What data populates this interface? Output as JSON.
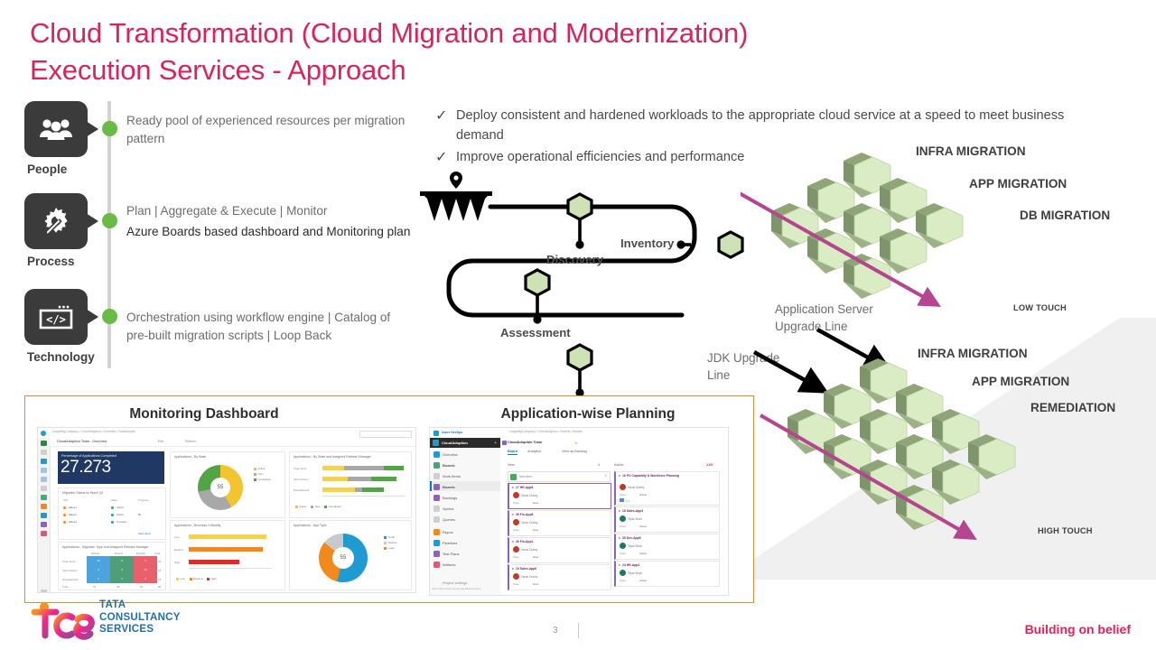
{
  "title": {
    "line1": "Cloud Transformation (Cloud Migration and Modernization)",
    "line2": "Execution Services - Approach",
    "color": "#d8235c"
  },
  "pillars": [
    {
      "label": "People",
      "icon": "people-icon",
      "text": "Ready pool of experienced resources per migration pattern"
    },
    {
      "label": "Process",
      "icon": "gear-wrench-icon",
      "text_primary": "Plan | Aggregate & Execute | Monitor",
      "text_secondary": "Azure Boards based dashboard and Monitoring  plan"
    },
    {
      "label": "Technology",
      "icon": "code-window-icon",
      "text": "Orchestration using workflow engine | Catalog of pre-built migration scripts | Loop Back"
    }
  ],
  "bullets": [
    "Deploy consistent and hardened  workloads to the  appropriate cloud service at a speed  to meet business  demand",
    "Improve operational efficiencies and performance"
  ],
  "flow": {
    "nodes": [
      "Discovery",
      "Inventory",
      "Assessment"
    ],
    "start_icon": "funnel-pin-icon"
  },
  "annotations": {
    "app_server": "Application Server Upgrade Line",
    "jdk": "JDK Upgrade Line"
  },
  "clusters": [
    {
      "name": "low-touch-cluster",
      "labels": [
        "INFRA MIGRATION",
        "APP MIGRATION",
        "DB MIGRATION"
      ],
      "touch": "LOW TOUCH"
    },
    {
      "name": "high-touch-cluster",
      "labels": [
        "INFRA MIGRATION",
        "APP MIGRATION",
        "REMEDIATION"
      ],
      "touch": "HIGH TOUCH"
    }
  ],
  "screenshots": {
    "dashboard": {
      "title": "Monitoring Dashboard",
      "breadcrumb": "LargeMigCompany  /  CloudAdoption  /  Overview  /  Dashboards",
      "search_placeholder": "Search",
      "toolbar_title": "CloudAdoption Team - Overview",
      "toolbar_edit": "Edit",
      "toolbar_refresh": "Refresh",
      "kpi": {
        "title": "Percentage of Applications Completed",
        "value": "27.273"
      },
      "wave_card": {
        "title": "Migration Status by Wave (3)",
        "columns": [
          "Title",
          "State",
          "Progress"
        ],
        "rows": [
          {
            "title": "Wave1",
            "state": "Active",
            "progress": ""
          },
          {
            "title": "Wave2",
            "state": "Active",
            "progress": "80"
          },
          {
            "title": "Wave3",
            "state": "Complet..",
            "progress": ""
          }
        ],
        "link": "View query"
      },
      "matrix_card": {
        "title": "Applications - Migration Type And Assigned Release Manager",
        "columns": [
          "Rehost",
          "Rehost",
          "Rebuild",
          "Total"
        ],
        "rows": [
          {
            "label": "Tejas Shah",
            "cells": [
              "44",
              "8",
              "4",
              "24"
            ]
          },
          {
            "label": "Varun Dubey",
            "cells": [
              "2",
              "3",
              "10",
              "18"
            ]
          },
          {
            "label": "Ramakanand",
            "cells": [
              "2",
              "4",
              "3",
              "16"
            ]
          }
        ],
        "total_row": {
          "label": "Total",
          "cells": [
            "26",
            "46",
            "51",
            "58"
          ]
        }
      },
      "donut_state": {
        "title": "Applications - By State",
        "center": "55",
        "legend": [
          "Active",
          "New",
          "Completed"
        ],
        "colors": [
          "#f4c430",
          "#a8a8a8",
          "#52a447"
        ]
      },
      "stacked_card": {
        "title": "Applications - By State and Assigned Release Manager",
        "rows": [
          "Tejas Shah",
          "Varun Dubey",
          "Ramakanand"
        ],
        "legend": [
          "Active",
          "New",
          "Completed"
        ]
      },
      "criticality_card": {
        "title": "Applications - Business Criticality",
        "rows": [
          "Low",
          "Medium",
          "High"
        ],
        "legend": [
          "Low",
          "Medium",
          "High"
        ],
        "colors": [
          "#f4d24a",
          "#f08a1d",
          "#e02b26"
        ]
      },
      "apptype_card": {
        "title": "Applications - App Type",
        "center": "55",
        "legend": [
          "Small",
          "Medium",
          "Large"
        ],
        "colors": [
          "#1f9bd1",
          "#f08a1d",
          "#c9c9c9"
        ]
      }
    },
    "planning": {
      "title": "Application-wise Planning",
      "brand": "Azure DevOps",
      "breadcrumb": "LargeMigCompany  /  CloudAdoption  /  Boards  /  Boards",
      "project": "CloudAdoption",
      "board_title": "CloudAdoption Team",
      "tabs": [
        "Board",
        "Analytics"
      ],
      "view_backlog": "View as Backlog",
      "nav": [
        "Overview",
        "Boards",
        "Work items",
        "Boards",
        "Backlogs",
        "Sprints",
        "Queries",
        "Repos",
        "Pipelines",
        "Test Plans",
        "Artifacts"
      ],
      "project_settings": "Project settings",
      "status_url": "https://dev.azure.com/LargeMigCompany",
      "columns": [
        {
          "name": "New",
          "count": "4",
          "new_item": "New item"
        },
        {
          "name": "Active",
          "count": "21/5"
        }
      ],
      "cards_new": [
        {
          "id": "17 HR-App8",
          "assignee": "Varun Dubey",
          "state_label": "State",
          "state": "New"
        },
        {
          "id": "35 Fin-App6",
          "assignee": "Varun Dubey",
          "state_label": "State",
          "state": "New"
        },
        {
          "id": "26 Fin-App1",
          "assignee": "Varun Dubey",
          "state_label": "State",
          "state": "New"
        },
        {
          "id": "19 Sales-App6",
          "assignee": "Varun Dubey",
          "state_label": "State",
          "state": "New"
        }
      ],
      "cards_active": [
        {
          "id": "16 PO Capability & Workforce Planning",
          "assignee": "Varun Dubey",
          "state_label": "State",
          "state": "Active",
          "extra": "0/1"
        },
        {
          "id": "18 Sales-App3",
          "assignee": "Tejas Shah",
          "state_label": "State",
          "state": "Active"
        },
        {
          "id": "39 Dev-App5",
          "assignee": "Tejas Shah",
          "state_label": "State",
          "state": "Active"
        },
        {
          "id": "24 HR-App3",
          "assignee": "Tejas Shah",
          "state_label": "State",
          "state": "Active"
        }
      ]
    }
  },
  "footer": {
    "page_number": "3",
    "tagline": "Building on belief",
    "logo_lines": [
      "TATA",
      "CONSULTANCY",
      "SERVICES"
    ]
  }
}
